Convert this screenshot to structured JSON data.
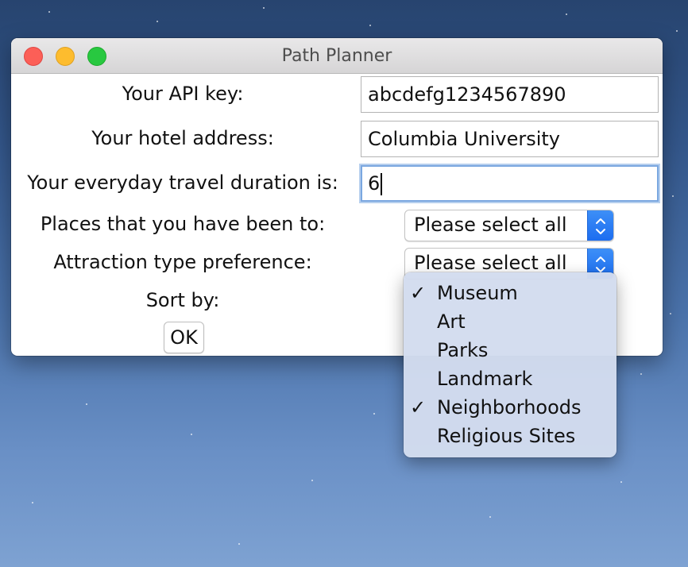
{
  "window": {
    "title": "Path Planner"
  },
  "form": {
    "api_key": {
      "label": "Your API key:",
      "value": "abcdefg1234567890"
    },
    "hotel_address": {
      "label": "Your hotel address:",
      "value": "Columbia University"
    },
    "travel_duration": {
      "label": "Your everyday travel duration is:",
      "value": "6"
    },
    "places_been": {
      "label": "Places that you have been to:",
      "selected": "Please select all"
    },
    "attraction_type": {
      "label": "Attraction type preference:",
      "selected": "Please select all"
    },
    "sort_by": {
      "label": "Sort by:"
    },
    "ok_label": "OK"
  },
  "attraction_menu": {
    "check_glyph": "✓",
    "items": [
      {
        "label": "Museum",
        "checked": true
      },
      {
        "label": "Art",
        "checked": false
      },
      {
        "label": "Parks",
        "checked": false
      },
      {
        "label": "Landmark",
        "checked": false
      },
      {
        "label": "Neighborhoods",
        "checked": true
      },
      {
        "label": "Religious Sites",
        "checked": false
      }
    ]
  },
  "colors": {
    "close": "#fc5f57",
    "minimize": "#fdbc2e",
    "zoom": "#28c840",
    "stepper": "#1c6df0",
    "focus_ring": "#7aa7e0",
    "menu_bg": "#d3dcee"
  }
}
